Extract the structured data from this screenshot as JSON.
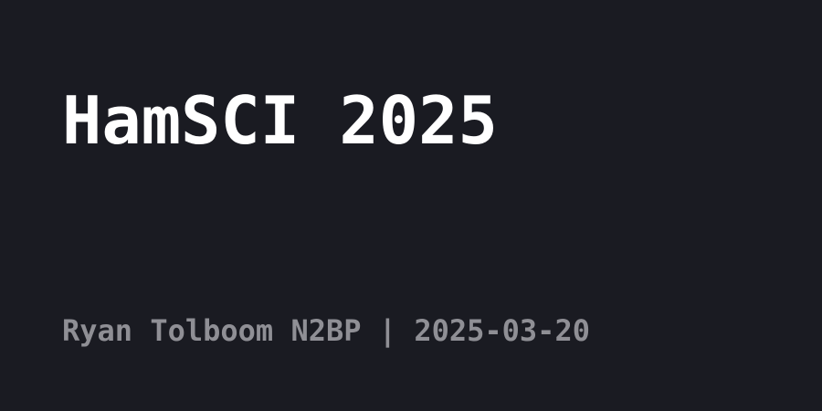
{
  "card": {
    "title": "HamSCI 2025",
    "footer": "Ryan Tolboom N2BP | 2025-03-20"
  },
  "colors": {
    "background": "#1a1b22",
    "title": "#ffffff",
    "footer": "#8f8f95"
  }
}
